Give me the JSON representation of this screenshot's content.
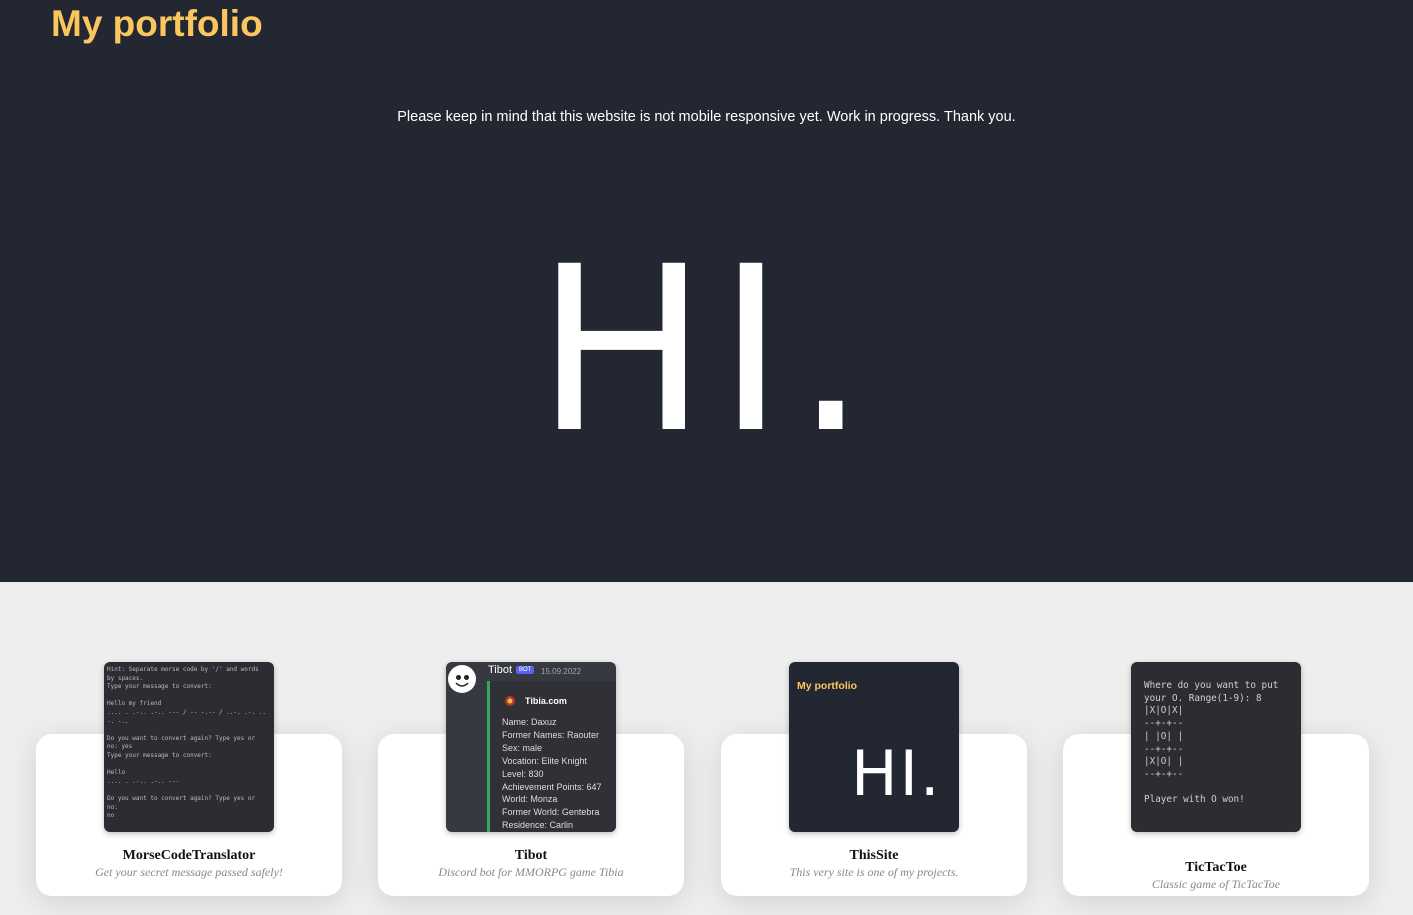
{
  "header": {
    "title": "My portfolio",
    "notice": "Please keep in mind that this website is not mobile responsive yet. Work in progress. Thank you."
  },
  "hero": {
    "greeting": "HI."
  },
  "colors": {
    "hero_bg": "#222732",
    "accent": "#fcc65e",
    "page_bg": "#eeeeee",
    "card_bg": "#ffffff"
  },
  "projects": [
    {
      "title": "MorseCodeTranslator",
      "subtitle": "Get your secret message passed safely!",
      "preview_text": "Hint: Separate morse code by '/' and words\nby spaces.\nType your message to convert:\n\nHello my friend\n.... . .-.. .-.. --- / -- -.-- / ..-. .-. ..\n-. -.. \n\nDo you want to convert again? Type yes or\nno: yes\nType your message to convert:\n\nHello\n.... . .-.. .-.. ---\n\nDo you want to convert again? Type yes or\nno:\nno"
    },
    {
      "title": "Tibot",
      "subtitle": "Discord bot for MMORPG game Tibia",
      "preview": {
        "bot_name": "Tibot",
        "badge": "BOT",
        "date": "15.09.2022",
        "provider": "Tibia.com",
        "lines": [
          "Name: Daxuz",
          "Former Names: Raouter",
          "Sex: male",
          "Vocation: Elite Knight",
          "Level: 830",
          "Achievement Points: 647",
          "World: Monza",
          "Former World: Gentebra",
          "Residence: Carlin"
        ]
      }
    },
    {
      "title": "ThisSite",
      "subtitle": "This very site is one of my projects.",
      "preview": {
        "title": "My portfolio",
        "greeting": "HI."
      }
    },
    {
      "title": "TicTacToe",
      "subtitle": "Classic game of TicTacToe",
      "preview_text": "Where do you want to put\nyour O. Range(1-9): 8\n|X|O|X|\n--+-+--\n| |O| |\n--+-+--\n|X|O| |\n--+-+--\n\nPlayer with O won!"
    }
  ]
}
